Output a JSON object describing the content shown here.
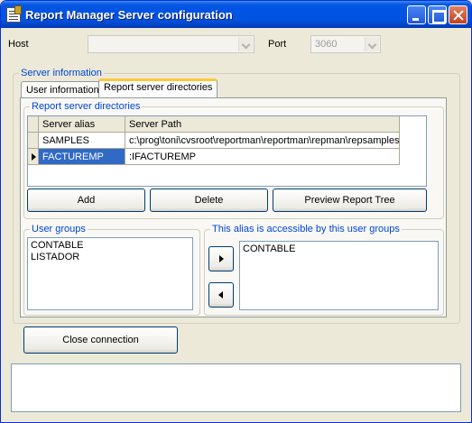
{
  "window": {
    "title": "Report Manager Server configuration"
  },
  "host": {
    "label": "Host",
    "value": ""
  },
  "port": {
    "label": "Port",
    "value": "3060"
  },
  "server_info": {
    "title": "Server information",
    "tabs": [
      {
        "label": "User information",
        "active": false
      },
      {
        "label": "Report server directories",
        "active": true
      }
    ]
  },
  "report_dirs": {
    "title": "Report server directories",
    "columns": [
      "Server alias",
      "Server Path"
    ],
    "rows": [
      {
        "alias": "SAMPLES",
        "path": "c:\\prog\\toni\\cvsroot\\reportman\\reportman\\repman\\repsamples",
        "current": false,
        "selected": false
      },
      {
        "alias": "FACTUREMP",
        "path": ":IFACTUREMP",
        "current": true,
        "selected": true
      }
    ],
    "buttons": {
      "add": "Add",
      "delete": "Delete",
      "preview": "Preview Report Tree"
    }
  },
  "user_groups": {
    "title": "User groups",
    "items": [
      "CONTABLE",
      "LISTADOR"
    ]
  },
  "alias_groups": {
    "title": "This alias is accessible by this user groups",
    "items": [
      "CONTABLE"
    ]
  },
  "close_connection": "Close connection"
}
